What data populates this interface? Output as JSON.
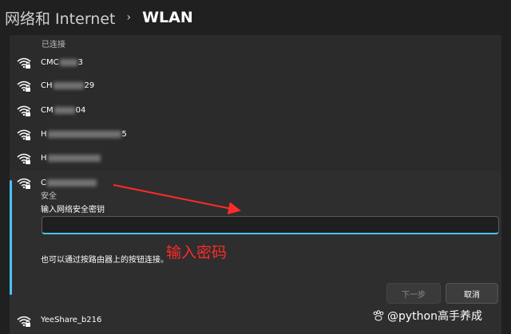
{
  "header": {
    "parent": "网络和 Internet",
    "separator": "›",
    "current": "WLAN"
  },
  "connected_label": "已连接",
  "networks": [
    {
      "prefix": "CMC",
      "suffix": "3"
    },
    {
      "prefix": "CH",
      "suffix": "29"
    },
    {
      "prefix": "CM",
      "suffix": "04"
    },
    {
      "prefix": "H",
      "suffix": "5"
    },
    {
      "prefix": "H",
      "suffix": ""
    }
  ],
  "selected": {
    "prefix": "C",
    "status": "安全",
    "password_label": "输入网络安全密钥",
    "password_value": "",
    "hint": "也可以通过按路由器上的按钮连接。",
    "next_label": "下一步",
    "cancel_label": "取消"
  },
  "annotation": "输入密码",
  "last_network": "YeeShare_b216",
  "watermark": "@python高手养成",
  "colors": {
    "accent": "#4cc2ff",
    "annotation": "#ff2a2a",
    "background": "#202020"
  }
}
